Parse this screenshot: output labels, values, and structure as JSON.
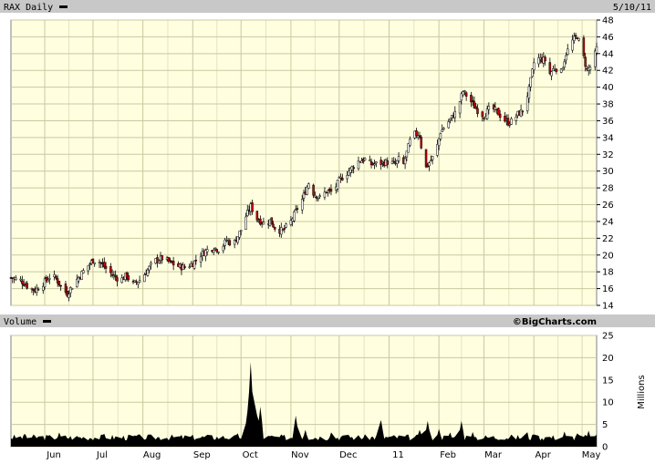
{
  "header": {
    "ticker_label": "RAX Daily",
    "date_label": "5/10/11"
  },
  "volume_panel": {
    "label": "Volume",
    "watermark": "©BigCharts.com",
    "unit_label": "Millions"
  },
  "colors": {
    "background": "#ffffe0",
    "grid": "#c8c8a0",
    "up_candle": "#000000",
    "down_candle": "#cc0000",
    "volume_fill": "#000000",
    "band": "#c8c8c8"
  },
  "chart_data": [
    {
      "type": "candlestick",
      "title": "RAX Daily",
      "y_ticks": [
        14,
        16,
        18,
        20,
        22,
        24,
        26,
        28,
        30,
        32,
        34,
        36,
        38,
        40,
        42,
        44,
        46,
        48
      ],
      "ylim": [
        14,
        48
      ],
      "x_tick_labels": [
        "Jun",
        "Jul",
        "Aug",
        "Sep",
        "Oct",
        "Nov",
        "Dec",
        "11",
        "Feb",
        "Mar",
        "Apr",
        "May"
      ],
      "x_tick_dates": [
        "2010-06-01",
        "2010-07-01",
        "2010-08-01",
        "2010-09-01",
        "2010-10-01",
        "2010-11-01",
        "2010-12-01",
        "2011-01-01",
        "2011-02-01",
        "2011-03-01",
        "2011-04-01",
        "2011-05-01"
      ],
      "date_range": [
        "2010-05-11",
        "2011-05-10"
      ],
      "close_points": [
        [
          "2010-05-11",
          17.3
        ],
        [
          "2010-05-17",
          17.0
        ],
        [
          "2010-05-21",
          16.3
        ],
        [
          "2010-05-26",
          15.8
        ],
        [
          "2010-06-01",
          16.8
        ],
        [
          "2010-06-05",
          17.6
        ],
        [
          "2010-06-08",
          17.2
        ],
        [
          "2010-06-12",
          16.0
        ],
        [
          "2010-06-15",
          15.4
        ],
        [
          "2010-06-19",
          16.6
        ],
        [
          "2010-06-23",
          17.6
        ],
        [
          "2010-06-26",
          18.3
        ],
        [
          "2010-07-01",
          19.4
        ],
        [
          "2010-07-05",
          19.2
        ],
        [
          "2010-07-10",
          18.2
        ],
        [
          "2010-07-14",
          17.5
        ],
        [
          "2010-07-18",
          17.0
        ],
        [
          "2010-07-22",
          17.6
        ],
        [
          "2010-07-25",
          16.4
        ],
        [
          "2010-07-30",
          17.0
        ],
        [
          "2010-08-04",
          18.2
        ],
        [
          "2010-08-08",
          19.3
        ],
        [
          "2010-08-13",
          19.6
        ],
        [
          "2010-08-17",
          19.2
        ],
        [
          "2010-08-22",
          18.7
        ],
        [
          "2010-08-27",
          18.5
        ],
        [
          "2010-09-01",
          19.0
        ],
        [
          "2010-09-05",
          19.9
        ],
        [
          "2010-09-10",
          20.6
        ],
        [
          "2010-09-14",
          20.9
        ],
        [
          "2010-09-18",
          20.6
        ],
        [
          "2010-09-22",
          21.8
        ],
        [
          "2010-09-26",
          21.2
        ],
        [
          "2010-10-01",
          23.0
        ],
        [
          "2010-10-04",
          24.6
        ],
        [
          "2010-10-07",
          25.8
        ],
        [
          "2010-10-11",
          24.3
        ],
        [
          "2010-10-15",
          23.8
        ],
        [
          "2010-10-19",
          24.1
        ],
        [
          "2010-10-23",
          23.0
        ],
        [
          "2010-10-27",
          22.9
        ],
        [
          "2010-11-01",
          24.0
        ],
        [
          "2010-11-05",
          25.6
        ],
        [
          "2010-11-08",
          26.6
        ],
        [
          "2010-11-12",
          28.6
        ],
        [
          "2010-11-15",
          27.4
        ],
        [
          "2010-11-19",
          26.8
        ],
        [
          "2010-11-23",
          27.6
        ],
        [
          "2010-11-27",
          27.5
        ],
        [
          "2010-12-01",
          28.9
        ],
        [
          "2010-12-05",
          29.6
        ],
        [
          "2010-12-09",
          30.4
        ],
        [
          "2010-12-13",
          31.2
        ],
        [
          "2010-12-17",
          31.4
        ],
        [
          "2010-12-21",
          30.8
        ],
        [
          "2010-12-25",
          30.9
        ],
        [
          "2011-01-01",
          31.1
        ],
        [
          "2011-01-05",
          30.8
        ],
        [
          "2011-01-07",
          31.4
        ],
        [
          "2011-01-10",
          30.8
        ],
        [
          "2011-01-14",
          33.6
        ],
        [
          "2011-01-17",
          34.4
        ],
        [
          "2011-01-20",
          34.4
        ],
        [
          "2011-01-23",
          30.1
        ],
        [
          "2011-01-26",
          31.0
        ],
        [
          "2011-01-30",
          32.2
        ],
        [
          "2011-02-02",
          34.7
        ],
        [
          "2011-02-05",
          35.4
        ],
        [
          "2011-02-09",
          36.4
        ],
        [
          "2011-02-12",
          37.2
        ],
        [
          "2011-02-16",
          39.5
        ],
        [
          "2011-02-19",
          38.8
        ],
        [
          "2011-02-23",
          37.7
        ],
        [
          "2011-02-26",
          37.0
        ],
        [
          "2011-03-01",
          36.6
        ],
        [
          "2011-03-05",
          37.6
        ],
        [
          "2011-03-09",
          37.1
        ],
        [
          "2011-03-13",
          36.2
        ],
        [
          "2011-03-16",
          35.8
        ],
        [
          "2011-03-19",
          36.0
        ],
        [
          "2011-03-22",
          36.8
        ],
        [
          "2011-03-25",
          37.2
        ],
        [
          "2011-03-29",
          39.7
        ],
        [
          "2011-04-01",
          42.9
        ],
        [
          "2011-04-04",
          43.4
        ],
        [
          "2011-04-08",
          43.2
        ],
        [
          "2011-04-11",
          41.6
        ],
        [
          "2011-04-14",
          42.4
        ],
        [
          "2011-04-18",
          41.8
        ],
        [
          "2011-04-21",
          44.0
        ],
        [
          "2011-04-25",
          45.5
        ],
        [
          "2011-04-28",
          46.1
        ],
        [
          "2011-05-01",
          44.3
        ],
        [
          "2011-05-04",
          42.0
        ],
        [
          "2011-05-07",
          42.6
        ],
        [
          "2011-05-10",
          44.6
        ]
      ],
      "hi_lo_swing": 0.8,
      "down_day_fraction": 0.45
    },
    {
      "type": "area",
      "title": "Volume",
      "y_ticks": [
        0,
        5,
        10,
        15,
        20,
        25
      ],
      "ylim": [
        0,
        25
      ],
      "ylabel": "Millions",
      "baseline": 1.4,
      "spikes": [
        [
          "2010-05-20",
          2.8
        ],
        [
          "2010-06-10",
          3.2
        ],
        [
          "2010-07-08",
          2.9
        ],
        [
          "2010-07-28",
          2.4
        ],
        [
          "2010-09-10",
          2.6
        ],
        [
          "2010-09-29",
          3.0
        ],
        [
          "2010-10-05",
          8.0
        ],
        [
          "2010-10-07",
          19.0
        ],
        [
          "2010-10-09",
          12.0
        ],
        [
          "2010-10-11",
          7.0
        ],
        [
          "2010-10-13",
          9.0
        ],
        [
          "2010-11-04",
          7.0
        ],
        [
          "2010-11-10",
          3.8
        ],
        [
          "2010-11-26",
          3.2
        ],
        [
          "2010-12-07",
          2.6
        ],
        [
          "2010-12-27",
          6.0
        ],
        [
          "2011-01-20",
          3.8
        ],
        [
          "2011-01-25",
          5.8
        ],
        [
          "2011-02-01",
          4.0
        ],
        [
          "2011-02-08",
          3.2
        ],
        [
          "2011-02-15",
          5.8
        ],
        [
          "2011-02-22",
          3.3
        ],
        [
          "2011-03-12",
          2.5
        ],
        [
          "2011-03-27",
          5.0
        ],
        [
          "2011-04-02",
          4.2
        ],
        [
          "2011-04-20",
          3.4
        ],
        [
          "2011-04-28",
          3.0
        ],
        [
          "2011-05-05",
          3.6
        ],
        [
          "2011-05-08",
          2.4
        ]
      ]
    }
  ]
}
